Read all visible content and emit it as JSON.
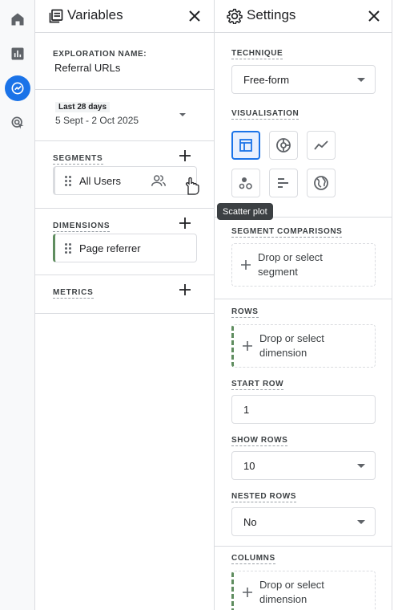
{
  "rail": {
    "items": [
      {
        "icon": "home-icon"
      },
      {
        "icon": "reports-icon"
      },
      {
        "icon": "explore-icon",
        "active": true
      },
      {
        "icon": "advertising-icon"
      }
    ]
  },
  "variables": {
    "title": "Variables",
    "exploration_label": "EXPLORATION NAME:",
    "exploration_name": "Referral URLs",
    "date_badge": "Last 28 days",
    "date_range": "5 Sept - 2 Oct 2025",
    "segments_label": "SEGMENTS",
    "segment_chip": "All Users",
    "dimensions_label": "DIMENSIONS",
    "dimension_chip": "Page referrer",
    "metrics_label": "METRICS"
  },
  "settings": {
    "title": "Settings",
    "technique_label": "TECHNIQUE",
    "technique_value": "Free-form",
    "visualisation_label": "VISUALISATION",
    "tooltip": "Scatter plot",
    "segment_comparisons_label": "SEGMENT COMPARISONS",
    "segment_drop": "Drop or select segment",
    "rows_label": "ROWS",
    "rows_drop": "Drop or select dimension",
    "start_row_label": "START ROW",
    "start_row_value": "1",
    "show_rows_label": "SHOW ROWS",
    "show_rows_value": "10",
    "nested_rows_label": "NESTED ROWS",
    "nested_rows_value": "No",
    "columns_label": "COLUMNS",
    "columns_drop": "Drop or select dimension"
  },
  "colors": {
    "accent": "#1a73e8",
    "dimension_accent": "#5f8d5f"
  }
}
